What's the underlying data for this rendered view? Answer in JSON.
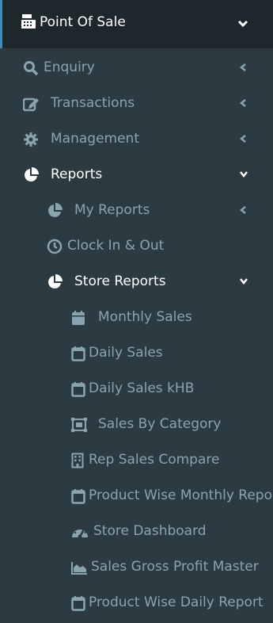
{
  "header": {
    "title": "Point Of Sale"
  },
  "menu": {
    "enquiry": "Enquiry",
    "transactions": "Transactions",
    "management": "Management",
    "reports": "Reports",
    "my_reports": "My Reports",
    "clock_in_out": "Clock In & Out",
    "store_reports": "Store Reports"
  },
  "store_reports_items": [
    {
      "label": "Monthly Sales",
      "icon": "calendar-solid-icon"
    },
    {
      "label": "Daily Sales",
      "icon": "calendar-icon"
    },
    {
      "label": "Daily Sales kHB",
      "icon": "calendar-icon"
    },
    {
      "label": "Sales By Category",
      "icon": "object-group-icon"
    },
    {
      "label": "Rep Sales Compare",
      "icon": "building-icon"
    },
    {
      "label": "Product Wise Monthly Report",
      "icon": "calendar-icon"
    },
    {
      "label": "Store Dashboard",
      "icon": "dashboard-icon"
    },
    {
      "label": "Sales Gross Profit Master",
      "icon": "area-chart-icon"
    },
    {
      "label": "Product Wise Daily Report",
      "icon": "calendar-icon"
    }
  ],
  "colors": {
    "sidebar_bg": "#2c3b41",
    "header_bg": "#1e282c",
    "accent": "#3c8dbc",
    "muted_text": "#8aa4af",
    "active_text": "#ffffff"
  }
}
